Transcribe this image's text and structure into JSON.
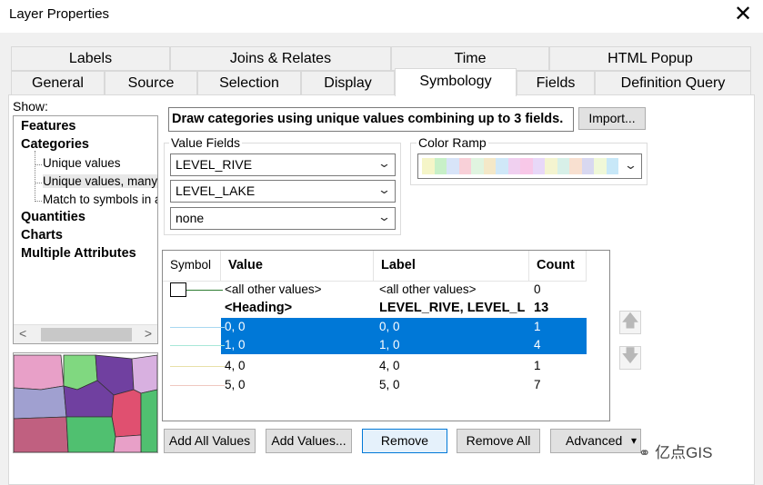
{
  "window": {
    "title": "Layer Properties",
    "close_glyph": "✕"
  },
  "tabs_row1": [
    "Labels",
    "Joins & Relates",
    "Time",
    "HTML Popup"
  ],
  "tabs_row2": [
    "General",
    "Source",
    "Selection",
    "Display",
    "Symbology",
    "Fields",
    "Definition Query"
  ],
  "active_tab": "Symbology",
  "show": {
    "label": "Show:",
    "items": [
      {
        "label": "Features",
        "level": 0
      },
      {
        "label": "Categories",
        "level": 0
      },
      {
        "label": "Unique values",
        "level": 1
      },
      {
        "label": "Unique values, many",
        "level": 1,
        "selected": true
      },
      {
        "label": "Match to symbols in a",
        "level": 1
      },
      {
        "label": "Quantities",
        "level": 0
      },
      {
        "label": "Charts",
        "level": 0
      },
      {
        "label": "Multiple Attributes",
        "level": 0
      }
    ],
    "scroll_left": "<",
    "scroll_right": ">"
  },
  "description": "Draw categories using unique values combining up to 3 fields.",
  "import_button": "Import...",
  "value_fields": {
    "label": "Value Fields",
    "fields": [
      "LEVEL_RIVE",
      "LEVEL_LAKE",
      "none"
    ]
  },
  "color_ramp": {
    "label": "Color Ramp",
    "colors": [
      "#f5f5c8",
      "#c8f0c8",
      "#d8e4f8",
      "#f8d0d8",
      "#e0f4e0",
      "#f4e8c8",
      "#d0e8f8",
      "#f0d0f0",
      "#f8c8e8",
      "#e8d8f8",
      "#f4f4d0",
      "#d8f0e8",
      "#f8e0d0",
      "#d8d8f0",
      "#f0f8d8",
      "#c8e8f8"
    ]
  },
  "table": {
    "headers": [
      "Symbol",
      "Value",
      "Label",
      "Count"
    ],
    "rows": [
      {
        "value": "<all other values>",
        "label": "<all other values>",
        "count": "0",
        "symbol": "box",
        "color": "#2e7d32"
      },
      {
        "value": "<Heading>",
        "label": "LEVEL_RIVE, LEVEL_L",
        "count": "13",
        "heading": true
      },
      {
        "value": "0, 0",
        "label": "0, 0",
        "count": "1",
        "selected": true,
        "color": "#a8d8f0"
      },
      {
        "value": "1, 0",
        "label": "1, 0",
        "count": "4",
        "selected": true,
        "color": "#a8e8d8"
      },
      {
        "value": "4, 0",
        "label": "4, 0",
        "count": "1",
        "color": "#e8e0a8"
      },
      {
        "value": "5, 0",
        "label": "5, 0",
        "count": "7",
        "color": "#f0c8c0"
      }
    ]
  },
  "move_up_glyph": "🡅",
  "move_down_glyph": "🡇",
  "buttons": {
    "add_all": "Add All Values",
    "add_values": "Add Values...",
    "remove": "Remove",
    "remove_all": "Remove All",
    "advanced": "Advanced",
    "advanced_arrow": "▾"
  },
  "watermark": "亿点GIS",
  "map_colors": [
    "#e8a0c8",
    "#80d880",
    "#7040a0",
    "#50c070",
    "#c06080",
    "#e05070",
    "#d8b0e0",
    "#a0a0d0"
  ]
}
